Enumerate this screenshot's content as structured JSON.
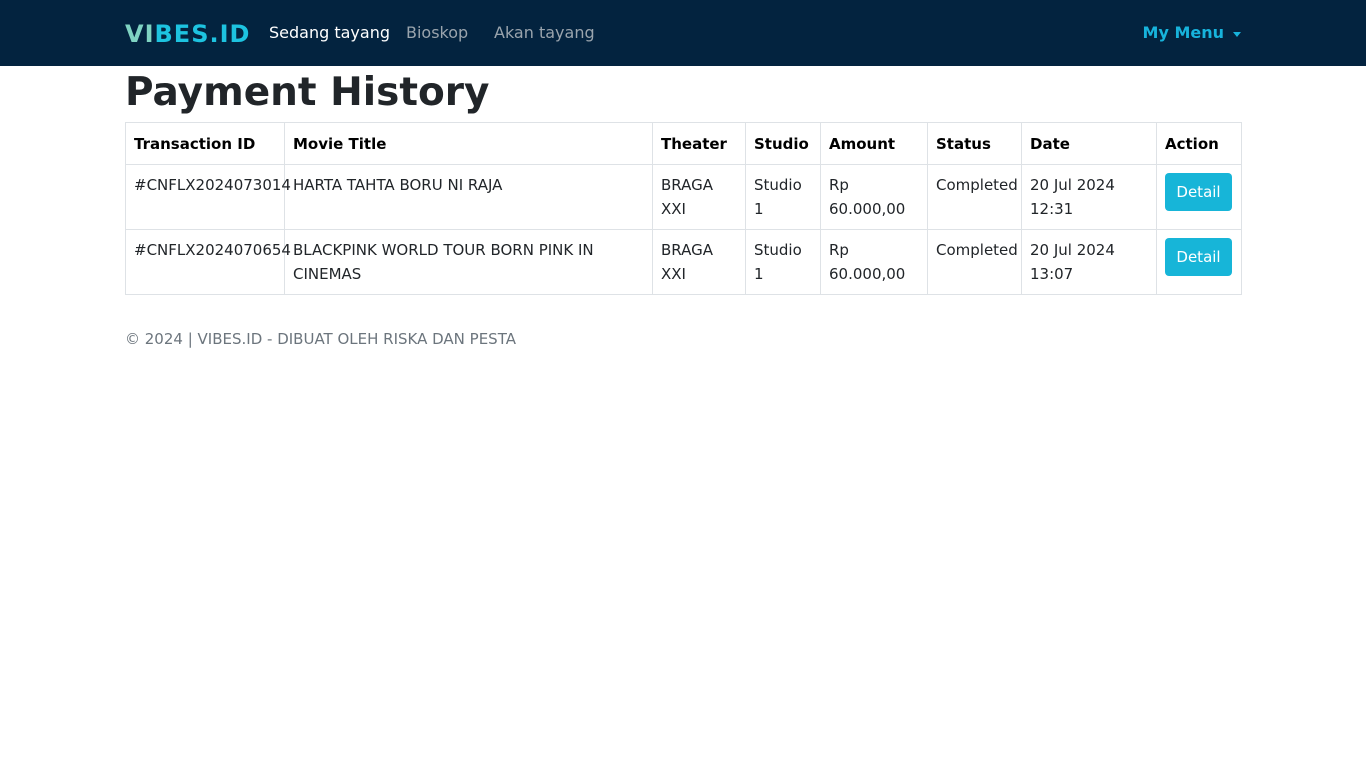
{
  "nav": {
    "brand_part1": "VI",
    "brand_part2": "BES.ID",
    "links": [
      "Sedang tayang",
      "Bioskop",
      "Akan tayang"
    ],
    "menu_label": "My Menu",
    "background_color": "#03233f",
    "menu_color": "#17b3dc"
  },
  "page": {
    "title": "Payment History"
  },
  "table": {
    "headers": [
      "Transaction ID",
      "Movie Title",
      "Theater",
      "Studio",
      "Amount",
      "Status",
      "Date",
      "Action"
    ],
    "rows": [
      {
        "transaction_id": "#CNFLX2024073014",
        "movie_title": "HARTA TAHTA BORU NI RAJA",
        "theater": "BRAGA XXI",
        "studio": "Studio 1",
        "amount": "Rp 60.000,00",
        "status": "Completed",
        "date": "20 Jul 2024 12:31",
        "action": "Detail"
      },
      {
        "transaction_id": "#CNFLX2024070654",
        "movie_title": "BLACKPINK WORLD TOUR BORN PINK IN CINEMAS",
        "theater": "BRAGA XXI",
        "studio": "Studio 1",
        "amount": "Rp 60.000,00",
        "status": "Completed",
        "date": "20 Jul 2024 13:07",
        "action": "Detail"
      }
    ],
    "button_color": "#17b5d8"
  },
  "footer": {
    "text": "© 2024 | VIBES.ID - DIBUAT OLEH RISKA DAN PESTA"
  }
}
